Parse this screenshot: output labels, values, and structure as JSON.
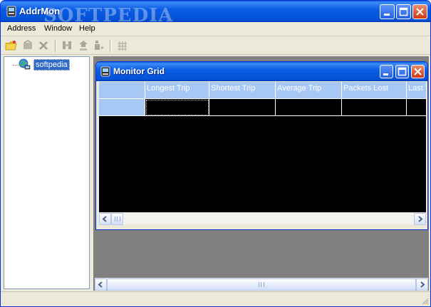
{
  "window": {
    "title": "AddrMon",
    "watermark": "SOFTPEDIA",
    "minimize_icon": "minimize-icon",
    "maximize_icon": "maximize-icon",
    "close_icon": "close-icon"
  },
  "menu": {
    "items": [
      {
        "label": "Address"
      },
      {
        "label": "Window"
      },
      {
        "label": "Help"
      }
    ]
  },
  "toolbar": {
    "buttons": [
      {
        "icon": "open-folder-icon",
        "enabled": true
      },
      {
        "icon": "address-book-icon",
        "enabled": false
      },
      {
        "icon": "delete-x-icon",
        "enabled": false
      },
      {
        "icon": "binoculars-icon",
        "enabled": false
      },
      {
        "icon": "network-ping-icon",
        "enabled": false
      },
      {
        "icon": "trace-route-icon",
        "enabled": false
      },
      {
        "icon": "grid-icon",
        "enabled": false
      }
    ]
  },
  "tree": {
    "items": [
      {
        "label": "softpedia",
        "icon": "globe-computer-icon",
        "selected": true
      }
    ]
  },
  "child_window": {
    "title": "Monitor Grid",
    "icon": "monitor-grid-app-icon"
  },
  "grid": {
    "columns": [
      "Longest Trip",
      "Shortest Trip",
      "Average Trip",
      "Packets Lost",
      "Last Trip"
    ],
    "rows": [
      [
        "",
        "",
        "",
        "",
        ""
      ]
    ]
  },
  "colors": {
    "title_blue": "#0553d6",
    "grid_header": "#a7c7f4",
    "grid_background": "#000000",
    "mdi_background": "#808080",
    "selection": "#316ac5"
  }
}
